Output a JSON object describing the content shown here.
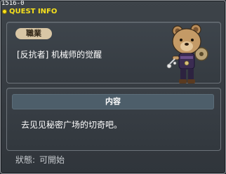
{
  "window": {
    "quest_id": "1516-0",
    "title": "QUEST INFO"
  },
  "quest": {
    "job_tag": "職業",
    "name": "[反抗者] 机械师的觉醒",
    "character_icon": "bear-costume-character"
  },
  "content": {
    "header": "内容",
    "text": "去见见秘密广场的切奇吧。"
  },
  "status": {
    "label": "狀態:",
    "value": "可開始"
  },
  "colors": {
    "title": "#f7e11c",
    "job_tag_bg": "#d8c6a5",
    "content_header_bg": "#4d5e6a"
  }
}
